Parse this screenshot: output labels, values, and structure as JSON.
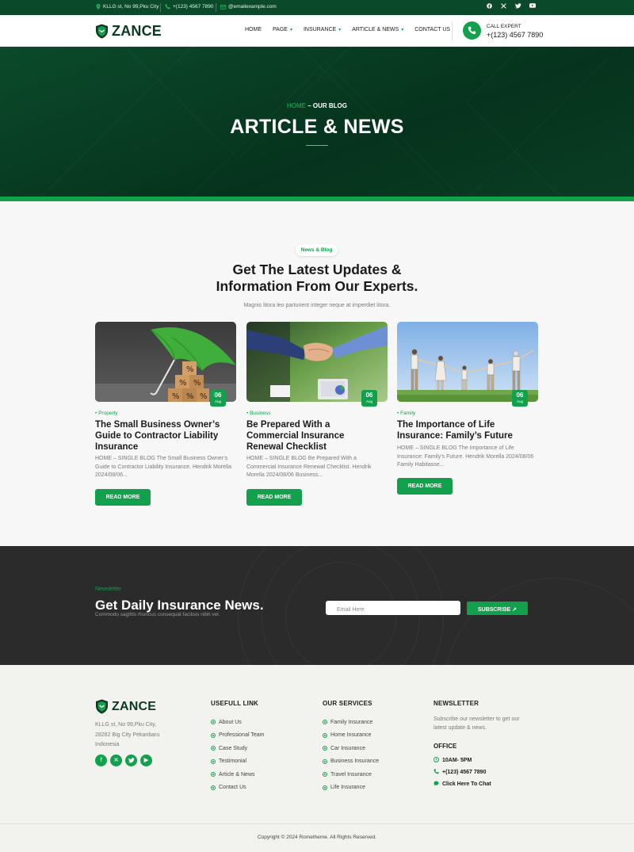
{
  "topbar": {
    "address": "KLLG st, No 99,Pku City",
    "phone": "+(123) 4567 7890",
    "email": "@emailexample.com"
  },
  "header": {
    "brand": "ZANCE",
    "nav": [
      "HOME",
      "PAGE",
      "INSURANCE",
      "ARTICLE & NEWS",
      "CONTACT US"
    ],
    "call_label": "CALL EXPERT",
    "call_number": "+(123) 4567 7890"
  },
  "hero": {
    "crumb_home": "HOME",
    "crumb_sep": " – ",
    "crumb_current": "OUR BLOG",
    "title": "ARTICLE & NEWS"
  },
  "blog": {
    "pill": "News & Blog",
    "title_line1": "Get The Latest Updates &",
    "title_line2": "Information From Our Experts.",
    "subtitle": "Magnis litora leo parturient integer neque at imperdiet litora.",
    "cards": [
      {
        "day": "06",
        "month": "Aug",
        "category": "Property",
        "title": "The Small Business Owner’s Guide to Contractor Liability Insurance",
        "excerpt": "HOME – SINGLE BLOG The Small Business Owner’s Guide to Contractor Liability Insurance. Hendrik Morella 2024/08/06...",
        "button": "READ MORE"
      },
      {
        "day": "06",
        "month": "Aug",
        "category": "Business",
        "title": "Be Prepared With a Commercial Insurance Renewal Checklist",
        "excerpt": "HOME – SINGLE BLOG Be Prepared With a Commercial Insurance Renewal Checklist. Hendrik Morella 2024/08/06 Business...",
        "button": "READ MORE"
      },
      {
        "day": "06",
        "month": "Aug",
        "category": "Family",
        "title": "The Importance of Life Insurance: Family’s Future",
        "excerpt": "HOME – SINGLE BLOG The Importance of Life Insurance: Family’s Future. Hendrik Morella 2024/08/06 Family Habitasse...",
        "button": "READ MORE"
      }
    ]
  },
  "newsletter": {
    "eyebrow": "Newsletter",
    "title": "Get Daily Insurance News.",
    "subtitle": "Commodo sagittis rhoncus consequat facilisis nibh vel.",
    "email_placeholder": "Email Here",
    "subscribe": "SUBSCRIBE ↗"
  },
  "footer": {
    "brand": "ZANCE",
    "address_line1": "KLLG st, No 99,Pku City,",
    "address_line2": "28282 Big City Pekanbaru",
    "address_line3": "Indonesia",
    "useful_title": "USEFULL LINK",
    "useful_links": [
      "About Us",
      "Professional Team",
      "Case Study",
      "Testimonial",
      "Article & News",
      "Contact Us"
    ],
    "services_title": "OUR SERVICES",
    "services": [
      "Family Insurance",
      "Home Insurance",
      "Car Insurance",
      "Business Insurance",
      "Travel Insurance",
      "Life Insurance"
    ],
    "newsletter_title": "NEWSLETTER",
    "newsletter_desc": "Subscribe our newsletter to get our latest update & news.",
    "office_title": "OFFICE",
    "hours": "10AM- 5PM",
    "phone": "+(123) 4567 7890",
    "chat": "Click Here To Chat",
    "copyright": "Copyright © 2024 Rometheme. All Rights Reserved."
  },
  "colors": {
    "brand_green": "#12a04c",
    "dark_green": "#0a4a2a",
    "newsletter_bg": "#2b2b2b"
  }
}
